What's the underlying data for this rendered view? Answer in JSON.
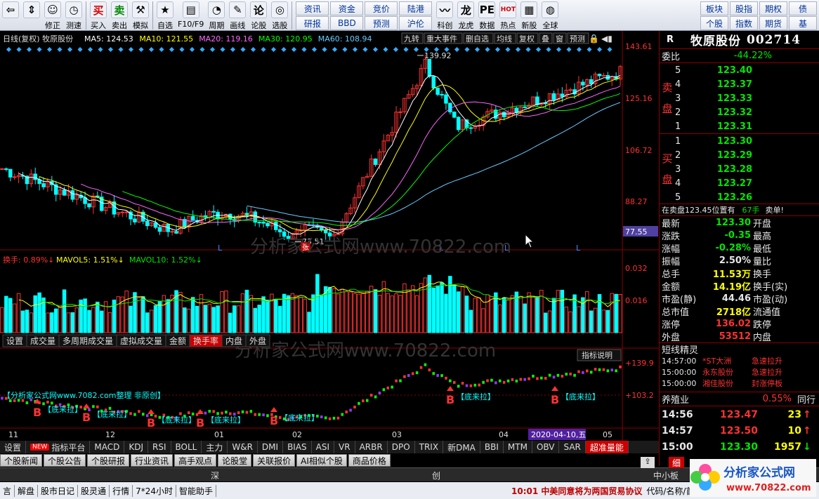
{
  "toolbar": {
    "left": [
      {
        "icon": "back-arrow-icon",
        "glyph": "⇦",
        "label": ""
      },
      {
        "icon": "up-down-arrow-icon",
        "glyph": "⇕",
        "label": ""
      },
      {
        "icon": "smiley-icon",
        "glyph": "☺",
        "label": "修正"
      },
      {
        "icon": "clock-icon",
        "glyph": "◷",
        "label": "测速"
      },
      {
        "icon": "buy-icon",
        "glyph": "买",
        "label": "买入"
      },
      {
        "icon": "sell-icon",
        "glyph": "卖",
        "label": "卖出"
      },
      {
        "icon": "hammer-icon",
        "glyph": "⚒",
        "label": "模拟"
      },
      {
        "icon": "star-icon",
        "glyph": "★",
        "label": "自选"
      },
      {
        "icon": "f10-icon",
        "glyph": "▤",
        "label": "F10/F9"
      },
      {
        "icon": "period-icon",
        "glyph": "◔",
        "label": "周期"
      },
      {
        "icon": "draw-line-icon",
        "glyph": "✎",
        "label": "画线"
      },
      {
        "icon": "forum-icon",
        "glyph": "论",
        "label": "论股"
      },
      {
        "icon": "select-stock-icon",
        "glyph": "◎",
        "label": "选股"
      }
    ],
    "grid": [
      "资讯",
      "资金",
      "竞价",
      "陆港",
      "研报",
      "BBD",
      "预测",
      "沪伦"
    ],
    "mid": [
      {
        "icon": "keling-icon",
        "glyph": "〰",
        "label": "科创"
      },
      {
        "icon": "dragon-icon",
        "glyph": "龙",
        "label": "龙虎"
      },
      {
        "icon": "pe-icon",
        "glyph": "PE",
        "label": "数据"
      },
      {
        "icon": "hot-icon",
        "glyph": "HOT",
        "label": "热点"
      },
      {
        "icon": "new-board-icon",
        "glyph": "▦",
        "label": "新股"
      },
      {
        "icon": "globe-icon",
        "glyph": "◍",
        "label": "全球"
      }
    ],
    "grid2": [
      "板块",
      "股指",
      "期权",
      "债",
      "个股",
      "指数",
      "期货",
      "基"
    ]
  },
  "chart": {
    "header_name": "日线(复权) 牧原股份",
    "ma": [
      {
        "label": "MA5: 124.53",
        "color": "#ffffff"
      },
      {
        "label": "MA10: 121.55",
        "color": "#ffff00"
      },
      {
        "label": "MA20: 119.16",
        "color": "#ff66ff"
      },
      {
        "label": "MA30: 120.95",
        "color": "#00ff00"
      },
      {
        "label": "MA60: 108.94",
        "color": "#66ccff"
      }
    ],
    "header_buttons": [
      "九转",
      "重大事件",
      "删自选",
      "均线",
      "复权",
      "叠",
      "窗",
      "预测"
    ],
    "price_axis": [
      "143.61",
      "125.16",
      "106.72",
      "88.27",
      "77.55"
    ],
    "high_label": "139.92",
    "low_label": "73.51",
    "zhang_label": "张",
    "l_marks": [
      "L",
      "L",
      "L",
      "L"
    ],
    "watermark": "分析家公式网www.70822.com",
    "vol_header": [
      {
        "label": "换手: 0.89%↓",
        "color": "#ff3232"
      },
      {
        "label": "MAVOL5: 1.51%↓",
        "color": "#ffff00"
      },
      {
        "label": "MAVOL10: 1.52%↓",
        "color": "#00e600"
      }
    ],
    "vol_axis": [
      "0.032",
      "0.016"
    ],
    "vol_tabs": [
      "设置",
      "成交量",
      "多周期成交量",
      "虚拟成交量",
      "金额",
      "换手率",
      "内盘",
      "外盘"
    ],
    "ind_explain": "指标说明",
    "ind_axis": [
      "+139.9",
      "+103.2"
    ],
    "ind_title": "【分析家公式网www.7082.com整理 非原创】",
    "ind_label": "【底来拉】",
    "b_label": "B",
    "x_axis": [
      "11",
      "12",
      "01",
      "02",
      "03",
      "04",
      "05"
    ],
    "x_date": "2020-04-10,五"
  },
  "indicator_tabs": [
    "设置",
    "指标平台",
    "MACD",
    "KDJ",
    "RSI",
    "BOLL",
    "主力",
    "W&R",
    "DMI",
    "BIAS",
    "ASI",
    "VR",
    "ARBR",
    "DPO",
    "TRIX",
    "新DMA",
    "BBI",
    "MTM",
    "OBV",
    "SAR",
    "超准量能"
  ],
  "new_badge": "NEW",
  "news_tabs": [
    "个股新闻",
    "个股公告",
    "个股研报",
    "行业资讯",
    "高手观点",
    "论股堂",
    "关联报价",
    "AI相似个股",
    "商品价格"
  ],
  "right": {
    "r_label": "R",
    "stock_name": "牧原股份",
    "stock_code": "002714",
    "weibi_label": "委比",
    "weibi": "-44.22%",
    "sell_side": "卖盘",
    "buy_side": "买盘",
    "sell": [
      {
        "n": "5",
        "p": "123.40"
      },
      {
        "n": "4",
        "p": "123.37"
      },
      {
        "n": "3",
        "p": "123.33"
      },
      {
        "n": "2",
        "p": "123.32"
      },
      {
        "n": "1",
        "p": "123.31"
      }
    ],
    "buy": [
      {
        "n": "1",
        "p": "123.30"
      },
      {
        "n": "2",
        "p": "123.29"
      },
      {
        "n": "3",
        "p": "123.28"
      },
      {
        "n": "4",
        "p": "123.27"
      },
      {
        "n": "5",
        "p": "123.26"
      }
    ],
    "notice": "在卖盘123.45位置有",
    "notice_qty": "67手",
    "notice_tag": "卖单!",
    "quotes": [
      {
        "k1": "最新",
        "v1": "123.30",
        "c1": "green",
        "k2": "开盘"
      },
      {
        "k1": "涨跌",
        "v1": "-0.35",
        "c1": "green",
        "k2": "最高"
      },
      {
        "k1": "涨幅",
        "v1": "-0.28%",
        "c1": "green",
        "k2": "最低"
      },
      {
        "k1": "振幅",
        "v1": "2.50%",
        "c1": "white",
        "k2": "量比"
      },
      {
        "k1": "总手",
        "v1": "11.53万",
        "c1": "yellow",
        "k2": "换手"
      },
      {
        "k1": "金额",
        "v1": "14.19亿",
        "c1": "yellow",
        "k2": "换手(实)"
      },
      {
        "k1": "市盈(静)",
        "v1": "44.46",
        "c1": "white",
        "k2": "市盈(动)"
      },
      {
        "k1": "总市值",
        "v1": "2718亿",
        "c1": "yellow",
        "k2": "流通值"
      },
      {
        "k1": "涨停",
        "v1": "136.02",
        "c1": "red",
        "k2": "跌停"
      },
      {
        "k1": "外盘",
        "v1": "53512",
        "c1": "red",
        "k2": "内盘"
      }
    ],
    "short_title": "短线精灵",
    "short": [
      {
        "t": "14:57:00",
        "n": "*ST大洲",
        "e": "急速拉升"
      },
      {
        "t": "15:00:00",
        "n": "永东股份",
        "e": "急速拉升"
      },
      {
        "t": "15:00:00",
        "n": "湘佳股份",
        "e": "封涨停板"
      }
    ],
    "sector_name": "养殖业",
    "sector_pct": "0.55%",
    "sector_more": "同行",
    "ticks": [
      {
        "t": "14:56",
        "p": "123.47",
        "v": "23",
        "dir": "↑",
        "c": "red"
      },
      {
        "t": "14:57",
        "p": "123.50",
        "v": "10",
        "dir": "↑",
        "c": "red"
      },
      {
        "t": "15:00",
        "p": "123.30",
        "v": "1957",
        "dir": "↓",
        "c": "green"
      }
    ],
    "tab_fine": "细"
  },
  "status1": {
    "left": "深",
    "mid": "创",
    "right": "中小板"
  },
  "status2": {
    "items": [
      "言",
      "解盘",
      "股市日记",
      "股灵通",
      "行情",
      "7*24小时",
      "智能助手"
    ],
    "ticker": "10:01 中美同意将为两国贸易协议",
    "right": "代码/名称/首"
  },
  "brand": {
    "text": "分析家公式网",
    "url": "www.70822.com"
  },
  "colors": {
    "up": "#ff3232",
    "down": "#00ffff",
    "accent": "#c00000"
  }
}
